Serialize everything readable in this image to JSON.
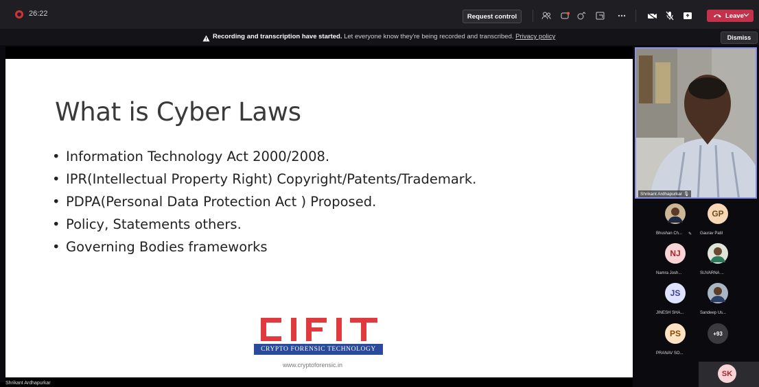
{
  "meeting": {
    "timer": "26:22"
  },
  "toolbar": {
    "request_control": "Request control",
    "leave": "Leave",
    "icons": [
      "people-icon",
      "chat-icon",
      "reactions-icon",
      "rooms-icon",
      "more-icon",
      "camera-icon",
      "mic-muted-icon",
      "share-icon"
    ]
  },
  "banner": {
    "bold": "Recording and transcription have started.",
    "text": " Let everyone know they're being recorded and transcribed. ",
    "link": "Privacy policy",
    "dismiss": "Dismiss"
  },
  "slide": {
    "title": "What is Cyber Laws",
    "bullets": [
      "Information Technology Act 2000/2008.",
      "IPR(Intellectual Property Right) Copyright/Patents/Trademark.",
      "PDPA(Personal Data Protection Act ) Proposed.",
      "Policy, Statements others.",
      "Governing Bodies frameworks"
    ],
    "logo_text": "CIFIT",
    "logo_tagline": "Crypto Forensic Technology",
    "logo_url": "www.cryptoforensic.in"
  },
  "presenter": {
    "name": "Shrikant Ardhapurkar"
  },
  "participants": [
    {
      "initials": "",
      "name": "Bhushan Ch...",
      "photo": true
    },
    {
      "initials": "GP",
      "name": "Gaurav Patil",
      "color": "#f7d7b5"
    },
    {
      "initials": "NJ",
      "name": "Namra Josh...",
      "color": "#f9d4d6"
    },
    {
      "initials": "",
      "name": "SUVARNA ...",
      "photo": true
    },
    {
      "initials": "JS",
      "name": "JINESH SHA...",
      "color": "#dfe3ff"
    },
    {
      "initials": "",
      "name": "Sandeep Us...",
      "photo": true
    },
    {
      "initials": "PS",
      "name": "PRANAV SO...",
      "color": "#fde2c4"
    },
    {
      "initials": "+93",
      "name": ""
    }
  ],
  "self": {
    "initials": "SK"
  },
  "colors": {
    "leave": "#c4314b",
    "accent": "#8b90e8",
    "topbar": "#1f1f23"
  }
}
